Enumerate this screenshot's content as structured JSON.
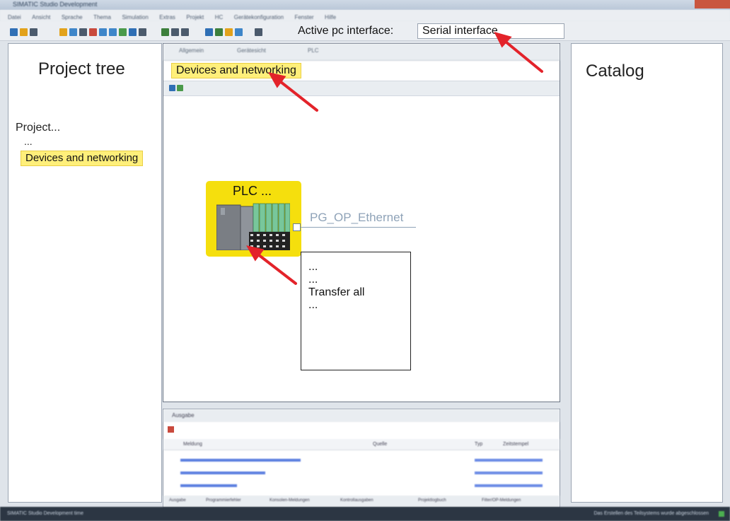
{
  "window": {
    "title": "SIMATIC Studio Development"
  },
  "menu": [
    "Datei",
    "Ansicht",
    "Sprache",
    "Thema",
    "Simulation",
    "Extras",
    "Projekt",
    "HC",
    "Gerätekonfiguration",
    "Fenster",
    "Hilfe"
  ],
  "toolbar": {
    "active_pc_label": "Active pc interface:",
    "active_pc_value": "Serial interface"
  },
  "project_tree": {
    "title": "Project tree",
    "items": [
      "Project...",
      "...",
      "Devices and networking"
    ]
  },
  "catalog": {
    "title": "Catalog"
  },
  "editor": {
    "tabs": [
      "Allgemein",
      "Gerätesicht",
      "PLC"
    ],
    "header": "Devices and networking",
    "plc_label": "PLC ...",
    "network_label": "PG_OP_Ethernet"
  },
  "context_menu": {
    "items": [
      "...",
      "...",
      "Transfer all",
      "..."
    ]
  },
  "output": {
    "title": "Ausgabe",
    "columns": [
      "Meldung",
      "Quelle",
      "Typ",
      "Zeitstempel"
    ],
    "footer_tabs": [
      "Ausgabe",
      "Programmierfehler",
      "Konsolen-Meldungen",
      "Kontrollausgaben",
      "Projektlogbuch",
      "Filter/OP-Meldungen"
    ]
  },
  "status": {
    "left": "SIMATIC Studio Development time",
    "right": "Das Erstellen des Teilsystems wurde abgeschlossen"
  },
  "colors": {
    "highlight": "#ffef7a",
    "plc_yellow": "#f5df0d",
    "arrow_red": "#e3232a",
    "network_gray": "#8fa3b8"
  }
}
